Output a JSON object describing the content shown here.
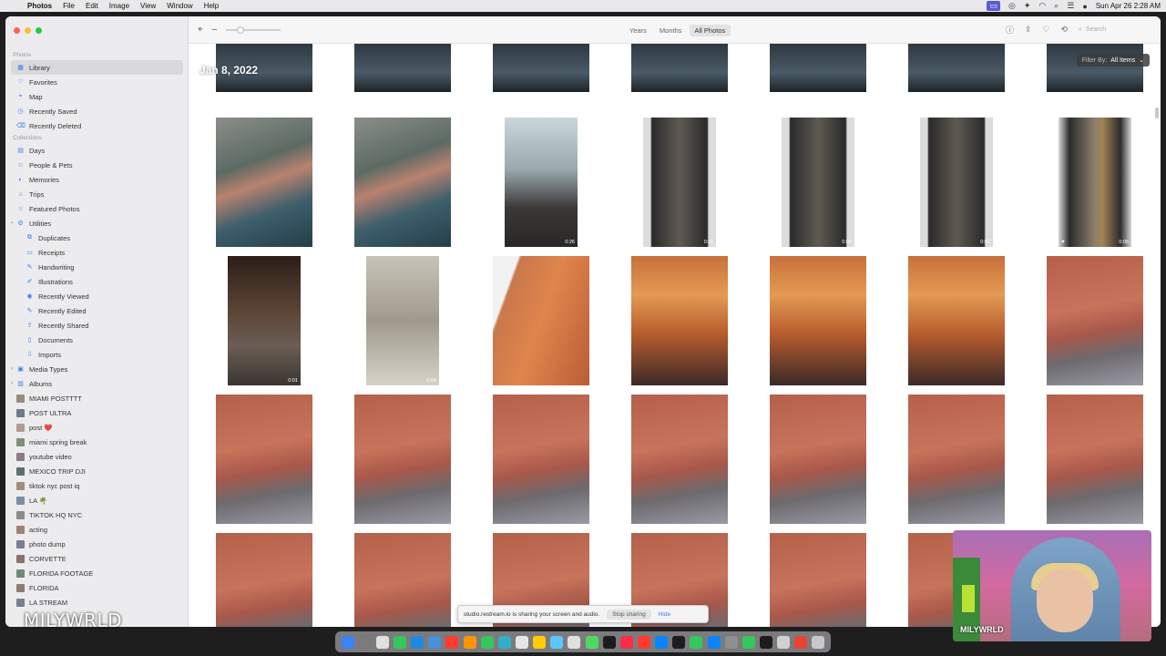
{
  "menubar": {
    "apple": "",
    "app_name": "Photos",
    "menus": [
      "File",
      "Edit",
      "Image",
      "View",
      "Window",
      "Help"
    ],
    "clock": "Sun Apr 26  2:28 AM"
  },
  "sidebar": {
    "sections": [
      {
        "header": "Photos",
        "items": [
          {
            "label": "Library",
            "icon": "library-icon",
            "selected": true
          },
          {
            "label": "Favorites",
            "icon": "heart-icon"
          },
          {
            "label": "Map",
            "icon": "map-icon"
          },
          {
            "label": "Recently Saved",
            "icon": "clock-icon"
          },
          {
            "label": "Recently Deleted",
            "icon": "trash-icon"
          }
        ]
      },
      {
        "header": "Collections",
        "items": [
          {
            "label": "Days",
            "icon": "calendar-icon"
          },
          {
            "label": "People & Pets",
            "icon": "person-icon"
          },
          {
            "label": "Memories",
            "icon": "memories-icon"
          },
          {
            "label": "Trips",
            "icon": "suitcase-icon"
          },
          {
            "label": "Featured Photos",
            "icon": "star-icon"
          },
          {
            "label": "Utilities",
            "icon": "utilities-icon",
            "disclosure": true
          },
          {
            "label": "Duplicates",
            "icon": "duplicate-icon",
            "indent": true
          },
          {
            "label": "Receipts",
            "icon": "receipt-icon",
            "indent": true
          },
          {
            "label": "Handwriting",
            "icon": "pen-icon",
            "indent": true
          },
          {
            "label": "Illustrations",
            "icon": "brush-icon",
            "indent": true
          },
          {
            "label": "Recently Viewed",
            "icon": "eye-icon",
            "indent": true
          },
          {
            "label": "Recently Edited",
            "icon": "edit-icon",
            "indent": true
          },
          {
            "label": "Recently Shared",
            "icon": "share-icon",
            "indent": true
          },
          {
            "label": "Documents",
            "icon": "document-icon",
            "indent": true
          },
          {
            "label": "Imports",
            "icon": "import-icon",
            "indent": true
          },
          {
            "label": "Media Types",
            "icon": "media-icon",
            "disclosure": true
          },
          {
            "label": "Albums",
            "icon": "album-icon",
            "disclosure": true
          }
        ]
      },
      {
        "header": "",
        "items": [
          {
            "label": "MIAMI POSTTTT",
            "album": true
          },
          {
            "label": "POST ULTRA",
            "album": true
          },
          {
            "label": "post ❤️",
            "album": true
          },
          {
            "label": "miami spring break",
            "album": true
          },
          {
            "label": "youtube video",
            "album": true
          },
          {
            "label": "MEXICO TRIP DJI",
            "album": true
          },
          {
            "label": "tiktok nyc post iq",
            "album": true
          },
          {
            "label": "LA 🌴",
            "album": true
          },
          {
            "label": "TIKTOK HQ NYC",
            "album": true
          },
          {
            "label": "acting",
            "album": true
          },
          {
            "label": "photo dump",
            "album": true
          },
          {
            "label": "CORVETTE",
            "album": true
          },
          {
            "label": "FLORIDA FOOTAGE",
            "album": true
          },
          {
            "label": "FLORIDA",
            "album": true
          },
          {
            "label": "LA STREAM",
            "album": true
          }
        ]
      }
    ]
  },
  "toolbar": {
    "view_tabs": [
      "Years",
      "Months",
      "All Photos"
    ],
    "active_tab": "All Photos",
    "search_placeholder": "Search"
  },
  "content": {
    "date_header": "Jan 8, 2022",
    "filter_prefix": "Filter By:",
    "filter_value": "All Items",
    "rows": [
      {
        "tiles": [
          {
            "style": "dark-top"
          },
          {
            "style": "dark-top"
          },
          {
            "style": "dark-top"
          },
          {
            "style": "dark-top"
          },
          {
            "style": "dark-top"
          },
          {
            "style": "dark-top"
          },
          {
            "style": "dark-top"
          }
        ]
      },
      {
        "tiles": [
          {
            "style": "pool",
            "duration": ""
          },
          {
            "style": "pool",
            "duration": ""
          },
          {
            "style": "window",
            "duration": "0:26",
            "narrow": true
          },
          {
            "style": "door",
            "duration": "0:11",
            "narrow": true
          },
          {
            "style": "door",
            "duration": "0:07",
            "narrow": true
          },
          {
            "style": "door",
            "duration": "0:07",
            "narrow": true
          },
          {
            "style": "doorwarm",
            "duration": "0:05",
            "narrow": true,
            "heart": true
          }
        ]
      },
      {
        "tiles": [
          {
            "style": "hall",
            "duration": "0:01",
            "narrow": true
          },
          {
            "style": "hallbright",
            "duration": "0:04",
            "narrow": true
          },
          {
            "style": "saltwall",
            "duration": ""
          },
          {
            "style": "saltglow",
            "duration": ""
          },
          {
            "style": "saltglow",
            "duration": ""
          },
          {
            "style": "saltglow",
            "duration": ""
          },
          {
            "style": "saltbench",
            "duration": ""
          }
        ]
      },
      {
        "tiles": [
          {
            "style": "saltbench"
          },
          {
            "style": "saltbench"
          },
          {
            "style": "saltbench"
          },
          {
            "style": "saltbench"
          },
          {
            "style": "saltbench"
          },
          {
            "style": "saltbench"
          },
          {
            "style": "saltbench"
          }
        ]
      },
      {
        "tiles": [
          {
            "style": "saltbench"
          },
          {
            "style": "saltbench"
          },
          {
            "style": "saltbench"
          },
          {
            "style": "saltbench"
          },
          {
            "style": "saltbench"
          },
          {
            "style": "saltbench"
          },
          {
            "style": "saltbench"
          }
        ]
      }
    ]
  },
  "share_bar": {
    "message": "studio.restream.io is sharing your screen and audio.",
    "stop_label": "Stop sharing",
    "hide_label": "Hide"
  },
  "overlay": {
    "watermark": "MILYWRLD",
    "camera_label": "MILYWRLD"
  },
  "colors": {
    "accent": "#3a7ee6",
    "sidebar_bg": "#ececee",
    "selection": "#d9d9dc"
  }
}
